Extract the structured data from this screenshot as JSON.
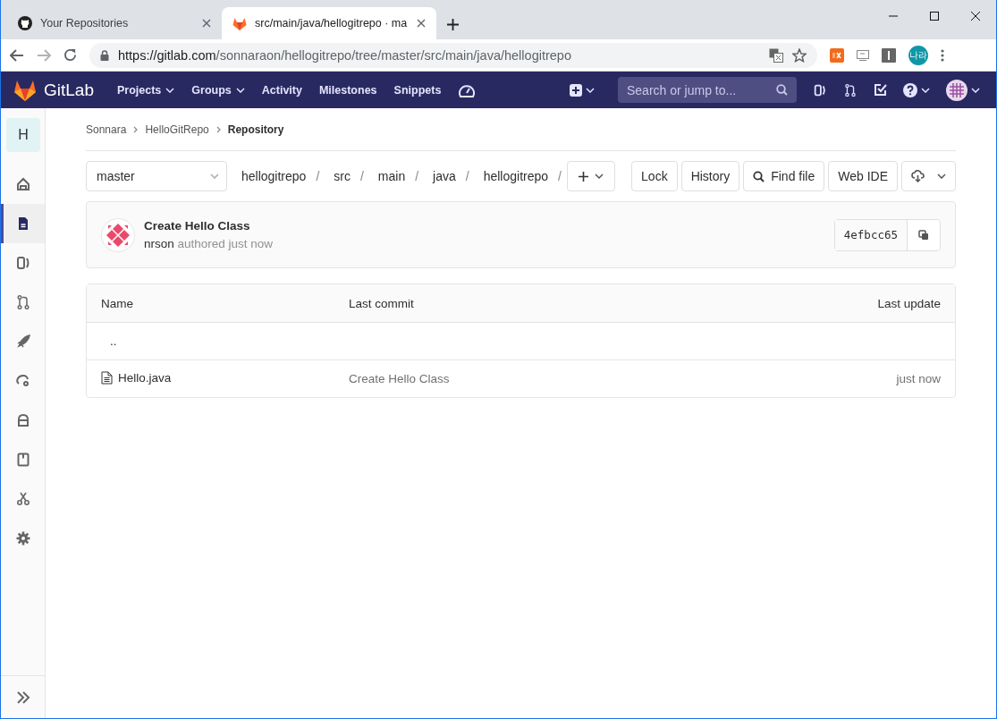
{
  "browser": {
    "tabs": [
      {
        "title": "Your Repositories",
        "kind": "github",
        "selected": false
      },
      {
        "title": "src/main/java/hellogitrepo · ma",
        "kind": "gitlab",
        "selected": true
      }
    ],
    "url": {
      "host": "https://gitlab.com",
      "path": "/sonnaraon/hellogitrepo/tree/master/src/main/java/hellogitrepo"
    },
    "profile": "나라"
  },
  "navbar": {
    "brand": "GitLab",
    "items": [
      {
        "label": "Projects",
        "dropdown": true
      },
      {
        "label": "Groups",
        "dropdown": true
      },
      {
        "label": "Activity",
        "dropdown": false
      },
      {
        "label": "Milestones",
        "dropdown": false
      },
      {
        "label": "Snippets",
        "dropdown": false
      }
    ],
    "search": {
      "placeholder": "Search or jump to..."
    }
  },
  "sidebar": {
    "project_letter": "H",
    "items": [
      {
        "selected": false
      },
      {
        "selected": true
      },
      {
        "selected": false
      },
      {
        "selected": false
      },
      {
        "selected": false
      },
      {
        "selected": false
      },
      {
        "selected": false
      },
      {
        "selected": false
      },
      {
        "selected": false
      },
      {
        "selected": false
      }
    ]
  },
  "breadcrumbs": [
    "Sonnara",
    "HelloGitRepo",
    "Repository"
  ],
  "branch": "master",
  "path": [
    {
      "name": "hellogitrepo",
      "separator": "/"
    },
    {
      "name": "src",
      "separator": "/"
    },
    {
      "name": "main",
      "separator": "/"
    },
    {
      "name": "java",
      "separator": "/"
    },
    {
      "name": "hellogitrepo",
      "separator": "/"
    }
  ],
  "actions": [
    {
      "label": "Lock",
      "kind": "plain"
    },
    {
      "label": "History",
      "kind": "plain"
    },
    {
      "label": "Find file",
      "kind": "search"
    },
    {
      "label": "Web IDE",
      "kind": "plain"
    }
  ],
  "commit": {
    "title": "Create Hello Class",
    "author": "nrson",
    "action": "authored just now",
    "sha": "4efbcc65"
  },
  "table": {
    "columns": [
      "Name",
      "Last commit",
      "Last update"
    ],
    "rows": [
      {
        "kind": "parent",
        "name": ".."
      },
      {
        "kind": "file",
        "name": "Hello.java",
        "last_commit": "Create Hello Class",
        "last_update": "just now"
      }
    ]
  }
}
